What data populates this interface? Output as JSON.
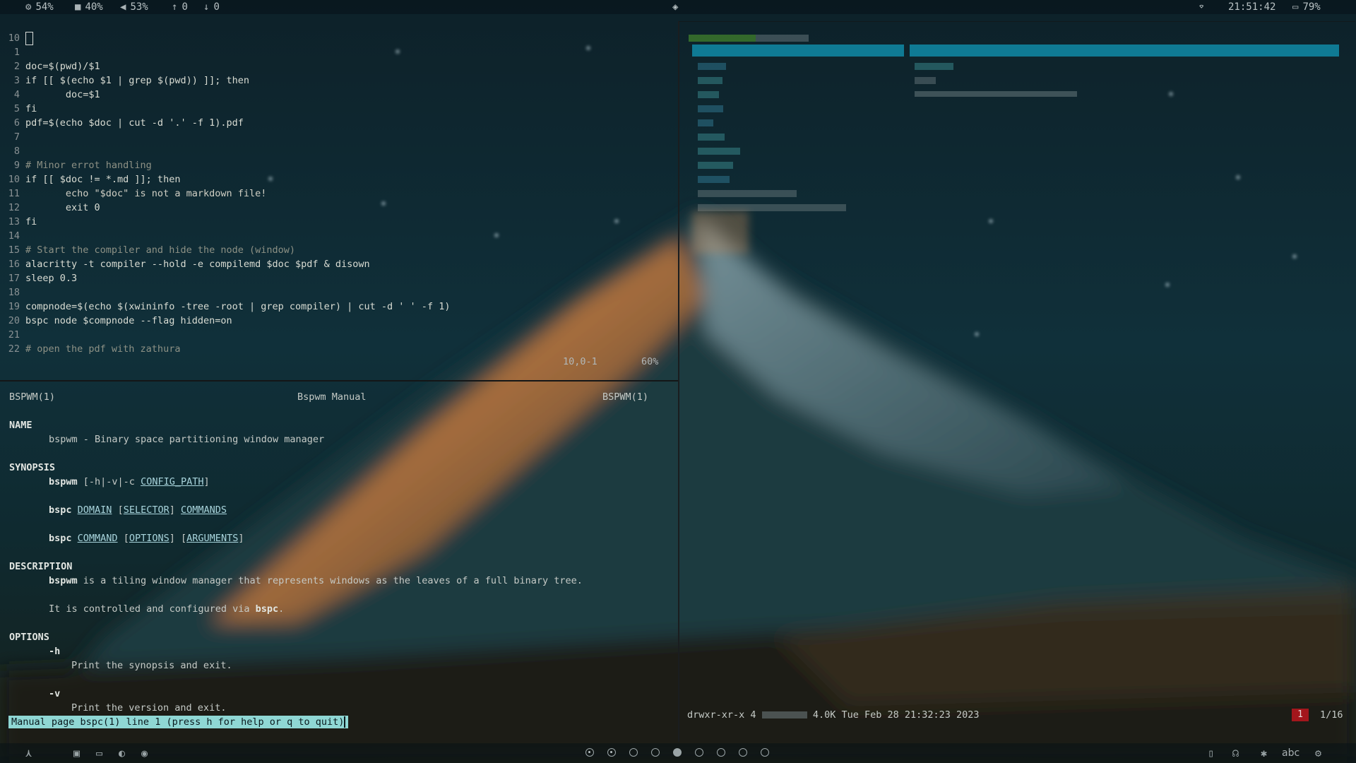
{
  "topbar": {
    "cpu": "54%",
    "disk": "40%",
    "volume": "53%",
    "up": "0",
    "down": "0",
    "time": "21:51:42",
    "battery": "79%"
  },
  "editor": {
    "lines": [
      {
        "n": "10",
        "t": ""
      },
      {
        "n": "1",
        "t": ""
      },
      {
        "n": "2",
        "t": "doc=$(pwd)/$1"
      },
      {
        "n": "3",
        "t": "if [[ $(echo $1 | grep $(pwd)) ]]; then"
      },
      {
        "n": "4",
        "t": "       doc=$1"
      },
      {
        "n": "5",
        "t": "fi"
      },
      {
        "n": "6",
        "t": "pdf=$(echo $doc | cut -d '.' -f 1).pdf"
      },
      {
        "n": "7",
        "t": ""
      },
      {
        "n": "8",
        "t": ""
      },
      {
        "n": "9",
        "t": "# Minor errot handling"
      },
      {
        "n": "10",
        "t": "if [[ $doc != *.md ]]; then"
      },
      {
        "n": "11",
        "t": "       echo \"$doc\" is not a markdown file!"
      },
      {
        "n": "12",
        "t": "       exit 0"
      },
      {
        "n": "13",
        "t": "fi"
      },
      {
        "n": "14",
        "t": ""
      },
      {
        "n": "15",
        "t": "# Start the compiler and hide the node (window)"
      },
      {
        "n": "16",
        "t": "alacritty -t compiler --hold -e compilemd $doc $pdf & disown"
      },
      {
        "n": "17",
        "t": "sleep 0.3"
      },
      {
        "n": "18",
        "t": ""
      },
      {
        "n": "19",
        "t": "compnode=$(echo $(xwininfo -tree -root | grep compiler) | cut -d ' ' -f 1)"
      },
      {
        "n": "20",
        "t": "bspc node $compnode --flag hidden=on"
      },
      {
        "n": "21",
        "t": ""
      },
      {
        "n": "22",
        "t": "# open the pdf with zathura"
      }
    ],
    "position": "10,0-1",
    "percent": "60%"
  },
  "man": {
    "header_left": "BSPWM(1)",
    "header_center": "Bspwm Manual",
    "header_right": "BSPWM(1)",
    "name_heading": "NAME",
    "name_text": "bspwm - Binary space partitioning window manager",
    "synopsis_heading": "SYNOPSIS",
    "syn1_cmd": "bspwm",
    "syn1_opts": "[-h|-v|-c",
    "syn1_arg": "CONFIG_PATH",
    "syn1_end": "]",
    "syn2_cmd": "bspc",
    "syn2_a": "DOMAIN",
    "syn2_b_open": "[",
    "syn2_b": "SELECTOR",
    "syn2_b_close": "]",
    "syn2_c": "COMMANDS",
    "syn3_cmd": "bspc",
    "syn3_a": "COMMAND",
    "syn3_b_open": "[",
    "syn3_b": "OPTIONS",
    "syn3_b_close": "]",
    "syn3_c_open": "[",
    "syn3_c": "ARGUMENTS",
    "syn3_c_close": "]",
    "desc_heading": "DESCRIPTION",
    "desc1_b": "bspwm",
    "desc1_rest": " is a tiling window manager that represents windows as the leaves of a full binary tree.",
    "desc2_a": "It is controlled and configured via ",
    "desc2_b": "bspc",
    "desc2_c": ".",
    "opt_heading": "OPTIONS",
    "opt_h": "-h",
    "opt_h_text": "Print the synopsis and exit.",
    "opt_v": "-v",
    "opt_v_text": "Print the version and exit.",
    "status": "Manual page bspc(1) line 1 (press h for help or q to quit)"
  },
  "filemanager": {
    "status_perm": "drwxr-xr-x 4",
    "status_info": "4.0K Tue Feb 28 21:32:23 2023",
    "badge": "1",
    "position": "1/16"
  },
  "bottombar": {
    "input_method": "abc"
  },
  "colors": {
    "accent": "#8fd7d4",
    "selection": "#0f7a94",
    "badge": "#a3161c",
    "number": "#e08a2c"
  }
}
